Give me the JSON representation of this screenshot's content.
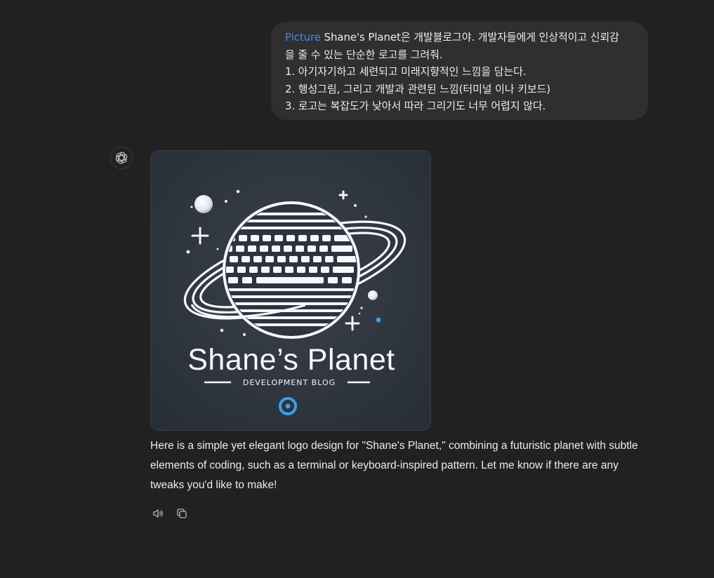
{
  "user_message": {
    "tag": "Picture",
    "first_line_rest": " Shane's Planet은 개발블로그야. 개발자들에게 인상적이고 신뢰감",
    "lines": [
      "을 줄 수 있는 단순한 로고를 그려줘.",
      "1. 아기자기하고 세련되고 미래지향적인 느낌을 담는다.",
      "2. 행성그림, 그리고 개발과 관련된 느낌(터미널 이나 키보드)",
      "3. 로고는 복잡도가 낮아서 따라 그리기도 너무 어렵지 않다."
    ]
  },
  "assistant": {
    "avatar_icon": "chatgpt-logo-icon",
    "image": {
      "logo_title": "Shane’s Planet",
      "logo_subtitle": "DEVELOPMENT BLOG",
      "background_color": "#2d3440",
      "accent_color": "#3aa0e8"
    },
    "response": "Here is a simple yet elegant logo design for \"Shane's Planet,\" combining a futuristic planet with subtle elements of coding, such as a terminal or keyboard-inspired pattern. Let me know if there are any tweaks you'd like to make!",
    "actions": [
      {
        "name": "read-aloud",
        "icon": "speaker-icon"
      },
      {
        "name": "copy",
        "icon": "copy-icon"
      }
    ]
  }
}
